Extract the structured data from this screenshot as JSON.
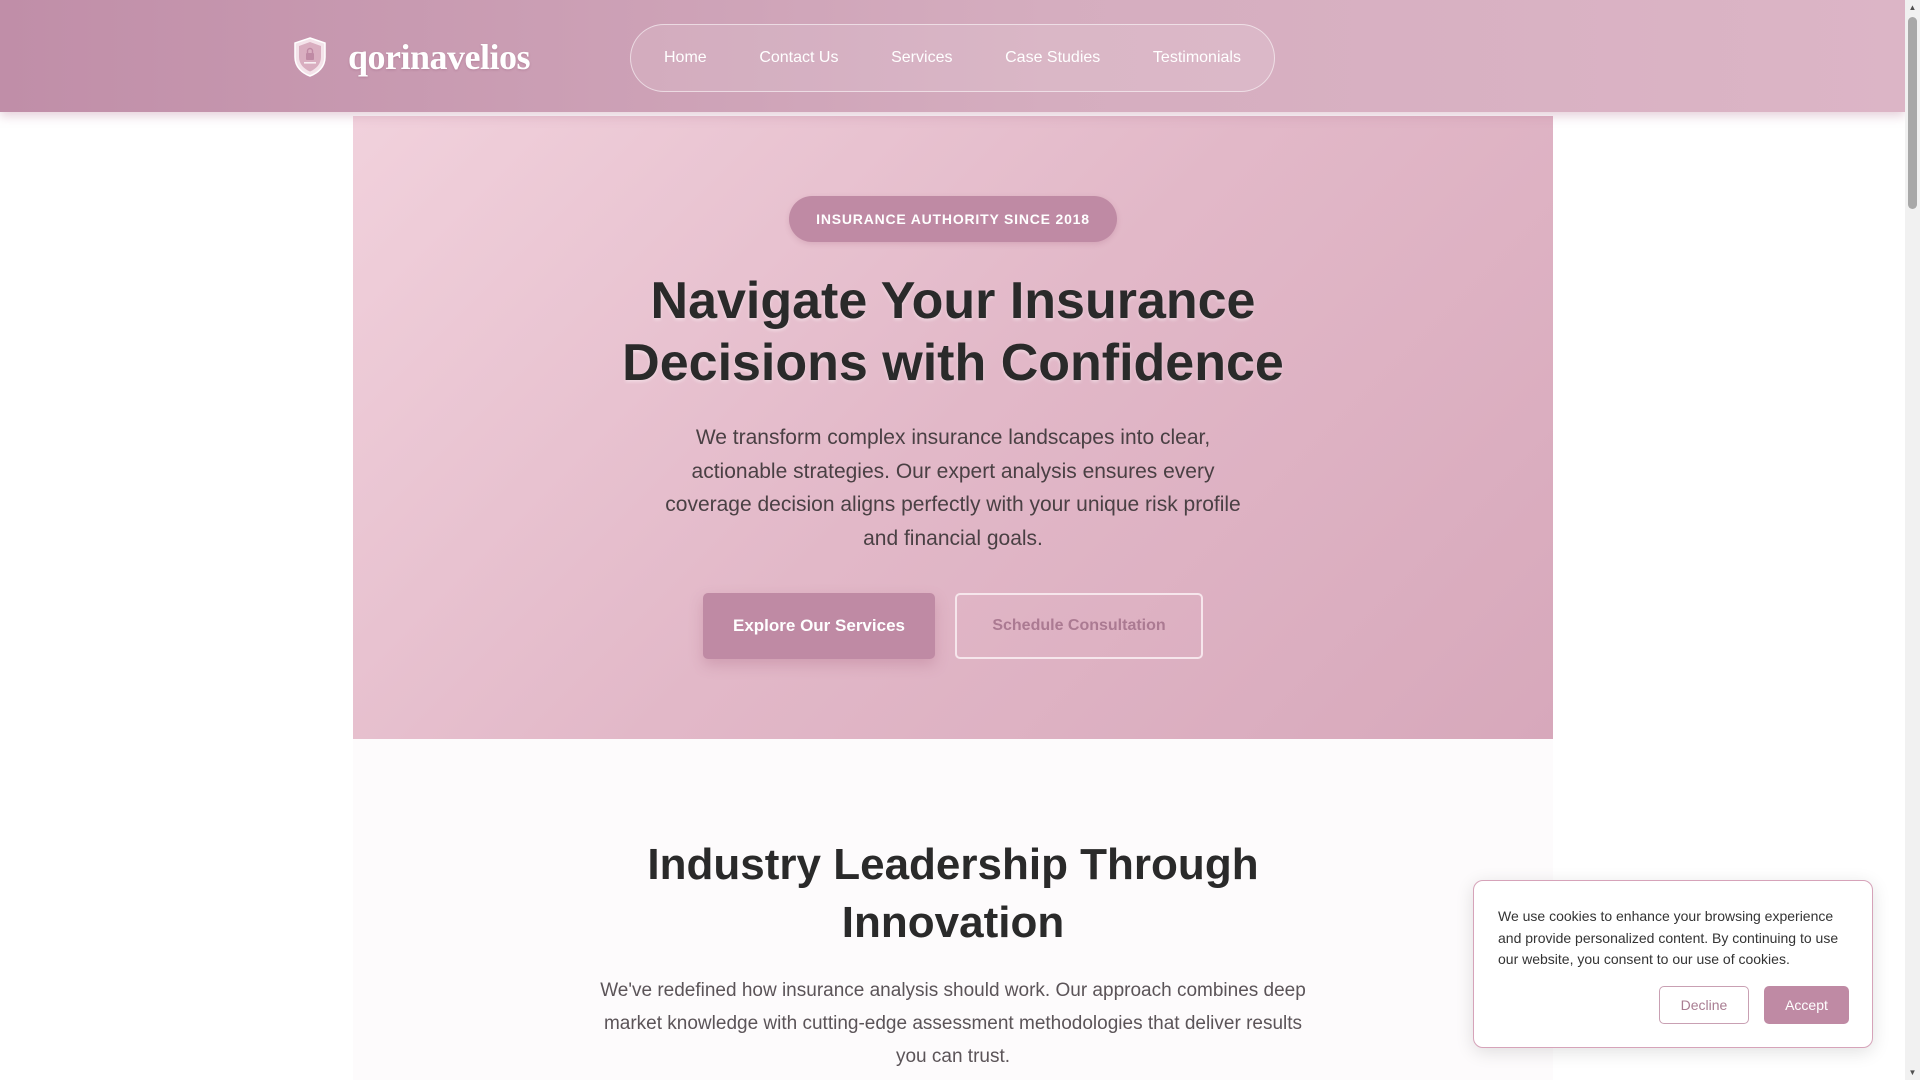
{
  "brand": {
    "name": "qorinavelios",
    "icon": "shield-lock-icon"
  },
  "nav": {
    "items": [
      {
        "label": "Home"
      },
      {
        "label": "Contact Us"
      },
      {
        "label": "Services"
      },
      {
        "label": "Case Studies"
      },
      {
        "label": "Testimonials"
      }
    ]
  },
  "hero": {
    "badge": "INSURANCE AUTHORITY SINCE 2018",
    "title": "Navigate Your Insurance Decisions with Confidence",
    "subtitle": "We transform complex insurance landscapes into clear, actionable strategies. Our expert analysis ensures every coverage decision aligns perfectly with your unique risk profile and financial goals.",
    "primary_cta": "Explore Our Services",
    "secondary_cta": "Schedule Consultation"
  },
  "leadership": {
    "title": "Industry Leadership Through Innovation",
    "text": "We've redefined how insurance analysis should work. Our approach combines deep market knowledge with cutting-edge assessment methodologies that deliver results you can trust."
  },
  "cookie": {
    "message": "We use cookies to enhance your browsing experience and provide personalized content. By continuing to use our website, you consent to our use of cookies.",
    "decline_label": "Decline",
    "accept_label": "Accept"
  },
  "colors": {
    "accent": "#bf8aa4",
    "header_start": "#c08ea8",
    "hero_start": "#f1d1dc",
    "hero_end": "#d7a8bb"
  }
}
